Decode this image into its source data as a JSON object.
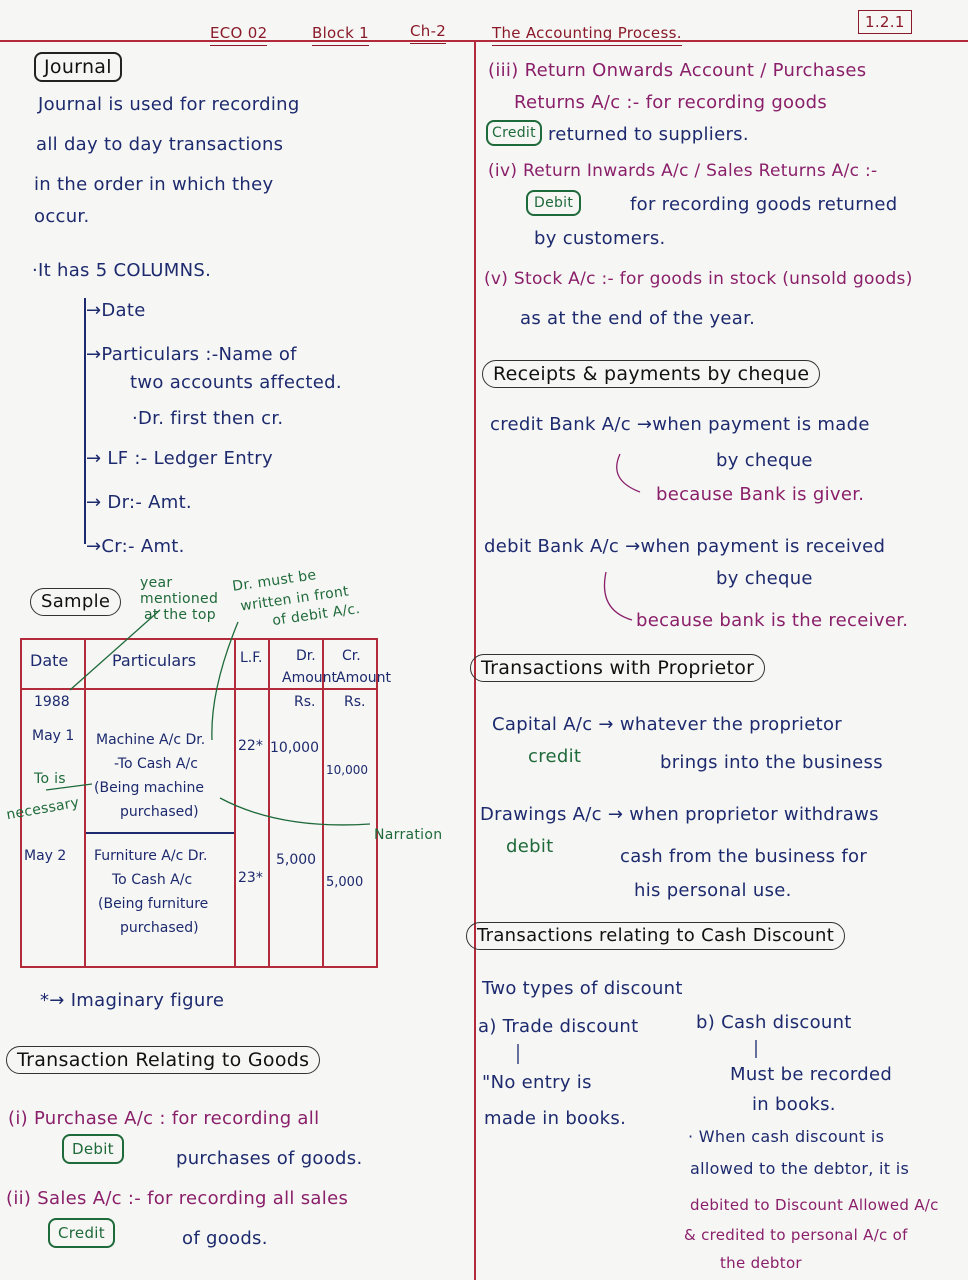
{
  "header": {
    "course": "ECO 02",
    "block": "Block 1",
    "chapter": "Ch-2",
    "title": "The Accounting Process.",
    "page_no": "1.2.1"
  },
  "left": {
    "journal_title": "Journal",
    "journal_def": [
      "Journal is used for recording",
      "all day to day transactions",
      "in the order in which they",
      "occur."
    ],
    "columns_head": "·It has 5 COLUMNS.",
    "columns": [
      "Date",
      "Particulars :-Name of",
      "two accounts affected.",
      "·Dr. first then cr.",
      "LF :- Ledger Entry",
      "Dr:- Amt.",
      "Cr:- Amt."
    ],
    "sample_label": "Sample",
    "note_year": [
      "year",
      "mentioned",
      "at the top"
    ],
    "note_dr": [
      "Dr. must be",
      "written in front",
      "of debit A/c."
    ],
    "table": {
      "headers": {
        "date": "Date",
        "particulars": "Particulars",
        "lf": "L.F.",
        "dr": "Dr.",
        "dr_sub": "Amount",
        "cr": "Cr.",
        "cr_sub": "Amount"
      },
      "year": "1988",
      "rs_dr": "Rs.",
      "rs_cr": "Rs.",
      "rows": [
        {
          "date": "May 1",
          "p1": "Machine A/c  Dr.",
          "p2": "-To Cash A/c",
          "p3": "(Being machine",
          "p4": "purchased)",
          "lf": "22*",
          "dr": "10,000",
          "cr": "10,000"
        },
        {
          "date": "May 2",
          "p1": "Furniture A/c  Dr.",
          "p2": "To Cash A/c",
          "p3": "(Being furniture",
          "p4": "purchased)",
          "lf": "23*",
          "dr": "5,000",
          "cr": "5,000"
        }
      ]
    },
    "note_to": [
      "To is",
      "necessary"
    ],
    "note_narration": "Narration",
    "imaginary": "*→ Imaginary figure",
    "goods_title": "Transaction Relating to Goods",
    "purchase_line": "(i) Purchase A/c  : for recording all",
    "purchase_tag": "Debit",
    "purchase_line2": "purchases of goods.",
    "sales_line": "(ii) Sales A/c :- for recording all sales",
    "sales_tag": "Credit",
    "sales_line2": "of goods."
  },
  "right": {
    "iii_line1": "(iii) Return Onwards Account / Purchases",
    "iii_line2": "Returns A/c :- for recording goods",
    "iii_tag": "Credit",
    "iii_line3": "returned to suppliers.",
    "iv_line1": "(iv) Return Inwards A/c / Sales Returns A/c :-",
    "iv_tag": "Debit",
    "iv_line2": "for recording goods returned",
    "iv_line3": "by customers.",
    "v_line1": "(v) Stock A/c :- for goods in stock (unsold goods)",
    "v_line2": "as at the end of the year.",
    "cheque_title": "Receipts & payments by cheque",
    "credit_bank": "credit Bank A/c  →when payment is made",
    "credit_bank2": "by cheque",
    "credit_because": "because Bank is giver.",
    "debit_bank": "debit  Bank A/c  →when payment is received",
    "debit_bank2": "by cheque",
    "debit_because": "because bank is the receiver.",
    "proprietor_title": "Transactions with Proprietor",
    "capital_line": "Capital A/c  →  whatever the proprietor",
    "capital_tag": "credit",
    "capital_line2": "brings into the business",
    "drawings_line": "Drawings A/c →  when proprietor withdraws",
    "drawings_tag": "debit",
    "drawings_line2": "cash from the business for",
    "drawings_line3": "his personal use.",
    "discount_title": "Transactions relating to Cash Discount",
    "two_types": "Two types of discount",
    "trade": "a) Trade discount",
    "cash": "b) Cash discount",
    "trade_note": [
      "\"No entry is",
      "made in books."
    ],
    "cash_note": [
      "Must be recorded",
      "in books."
    ],
    "cash_detail": [
      "· When cash discount is",
      "allowed to the debtor, it is",
      "debited to Discount Allowed A/c",
      "& credited to personal A/c of",
      "the debtor"
    ]
  }
}
